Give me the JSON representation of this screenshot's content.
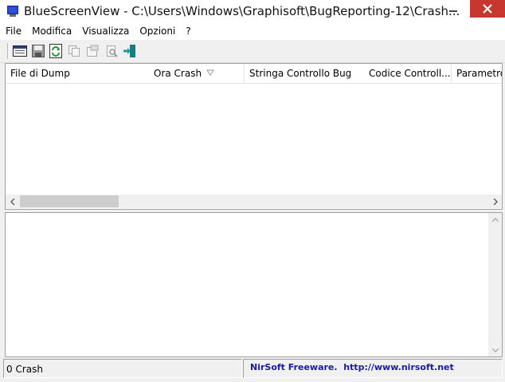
{
  "window": {
    "title": "BlueScreenView  -  C:\\Users\\Windows\\Graphisoft\\BugReporting-12\\Crash...",
    "controls": {
      "minimize_icon": "minimize-icon",
      "maximize_icon": "maximize-icon",
      "close_icon": "close-icon",
      "close_color": "#c7372f"
    }
  },
  "menu": {
    "items": [
      "File",
      "Modifica",
      "Visualizza",
      "Opzioni",
      "?"
    ]
  },
  "toolbar": {
    "buttons": [
      "html-report-icon",
      "save-icon",
      "refresh-icon",
      "copy-icon",
      "properties-icon",
      "find-icon",
      "exit-icon"
    ]
  },
  "list": {
    "columns": [
      "File di Dump",
      "Ora Crash",
      "Stringa Controllo Bug",
      "Codice Controll...",
      "Parametro"
    ],
    "sorted_column": "Ora Crash",
    "rows": []
  },
  "status": {
    "count": "0 Crash",
    "credit": "NirSoft Freeware.  http://www.nirsoft.net",
    "credit_color": "#1a1aa6"
  }
}
